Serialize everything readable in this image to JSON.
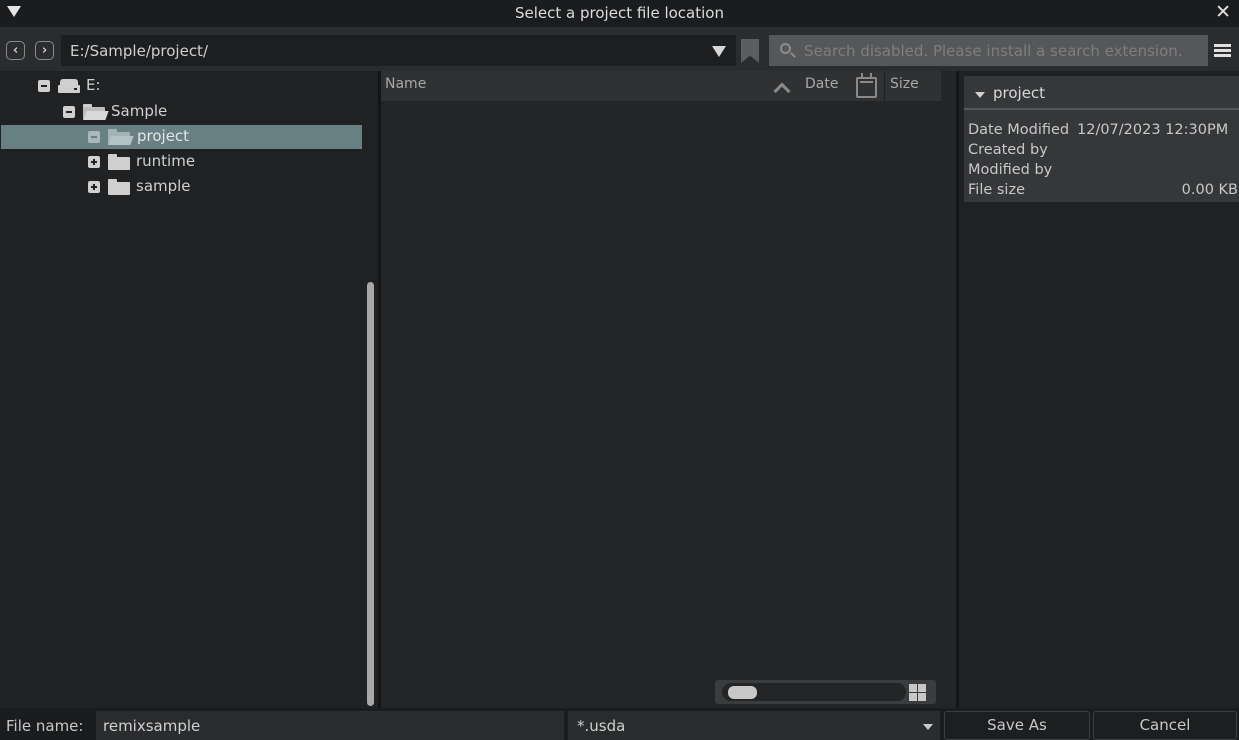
{
  "window": {
    "title": "Select a project file location",
    "close_glyph": "✕"
  },
  "toolbar": {
    "back_glyph": "‹",
    "forward_glyph": "›",
    "path": "E:/Sample/project/",
    "search_placeholder": "Search disabled. Please install a search extension."
  },
  "tree": {
    "items": [
      {
        "label": "E:",
        "icon": "drive-icon",
        "expander": "collapse",
        "depth": 0
      },
      {
        "label": "Sample",
        "icon": "folder-open-icon",
        "expander": "collapse",
        "depth": 1
      },
      {
        "label": "project",
        "icon": "folder-open-icon",
        "expander": "collapse",
        "depth": 2,
        "selected": true
      },
      {
        "label": "runtime",
        "icon": "folder-icon",
        "expander": "expand",
        "depth": 2
      },
      {
        "label": "sample",
        "icon": "folder-icon",
        "expander": "expand",
        "depth": 2
      }
    ]
  },
  "filelist": {
    "columns": {
      "name": "Name",
      "date": "Date",
      "size": "Size"
    },
    "rows": []
  },
  "info": {
    "title": "project",
    "fields": [
      {
        "key": "Date Modified",
        "value": "12/07/2023 12:30PM"
      },
      {
        "key": "Created by",
        "value": ""
      },
      {
        "key": "Modified by",
        "value": ""
      },
      {
        "key": "File size",
        "value": "0.00 KB"
      }
    ]
  },
  "bottom": {
    "file_name_label": "File name:",
    "file_name_value": "remixsample",
    "filter_value": "*.usda",
    "save_label": "Save As",
    "cancel_label": "Cancel"
  },
  "colors": {
    "background": "#1f2123",
    "selection": "#687f84",
    "panel": "#2a2c2e"
  }
}
